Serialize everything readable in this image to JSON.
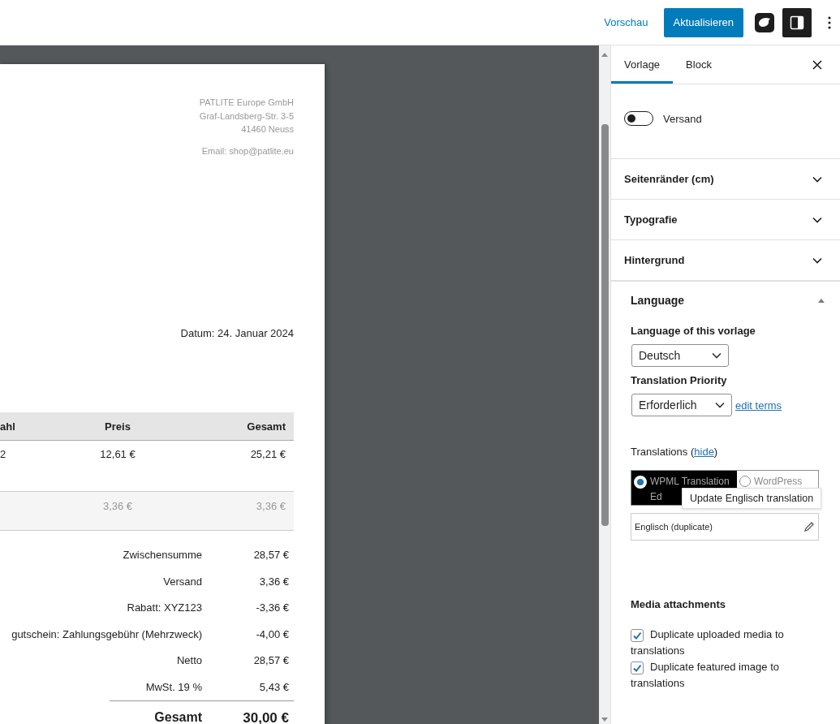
{
  "toolbar": {
    "preview": "Vorschau",
    "update": "Aktualisieren"
  },
  "document": {
    "sender": [
      "PATLITE Europe GmbH",
      "Graf-Landsberg-Str. 3-5",
      "41460 Neuss"
    ],
    "email": "Email: shop@patlite.eu",
    "date": "Datum: 24. Januar 2024",
    "table": {
      "columns": [
        "ahl",
        "Preis",
        "Gesamt"
      ],
      "rows": [
        {
          "column_1": "2",
          "price": "12,61 €",
          "total": "25,21 €",
          "muted": false
        },
        {
          "price": "3,36 €",
          "total": "3,36 €",
          "muted": true
        }
      ]
    },
    "totals": [
      {
        "label": "Zwischensumme",
        "value": "28,57 €"
      },
      {
        "label": "Versand",
        "value": "3,36 €"
      },
      {
        "label": "Rabatt: XYZ123",
        "value": "-3,36 €"
      },
      {
        "label": "gutschein: Zahlungsgebühr (Mehrzweck)",
        "value": "-4,00 €"
      },
      {
        "label": "Netto",
        "value": "28,57 €"
      },
      {
        "label": "MwSt. 19 %",
        "value": "5,43 €"
      }
    ],
    "grand_total": {
      "label": "Gesamt",
      "value": "30,00 €"
    }
  },
  "sidebar": {
    "tabs": [
      {
        "label": "Vorlage",
        "selected": true
      },
      {
        "label": "Block",
        "selected": false
      }
    ],
    "toggles": [
      {
        "label": "Versand",
        "on": false
      }
    ],
    "panels": [
      {
        "title": "Seitenränder (cm)",
        "expanded": false
      },
      {
        "title": "Typografie",
        "expanded": false
      },
      {
        "title": "Hintergrund",
        "expanded": false
      }
    ],
    "language": {
      "title": "Language",
      "expanded": true,
      "language_label": "Language of this vorlage",
      "language_value": "Deutsch",
      "priority_label": "Translation Priority",
      "priority_value": "Erforderlich",
      "edit_link": "edit terms",
      "translations_prefix": "Translations (",
      "translations_link": "hide",
      "translations_suffix": ")",
      "editors": [
        {
          "label": "WPML Translation Ed",
          "selected": true
        },
        {
          "label": "WordPress",
          "selected": false
        }
      ],
      "tooltip": "Update Englisch translation",
      "translations": [
        {
          "label": "Englisch (duplicate)"
        }
      ],
      "media_title": "Media attachments",
      "media_options": [
        {
          "label": "Duplicate uploaded media to translations",
          "checked": true
        },
        {
          "label": "Duplicate featured image to translations",
          "checked": true
        }
      ]
    }
  }
}
